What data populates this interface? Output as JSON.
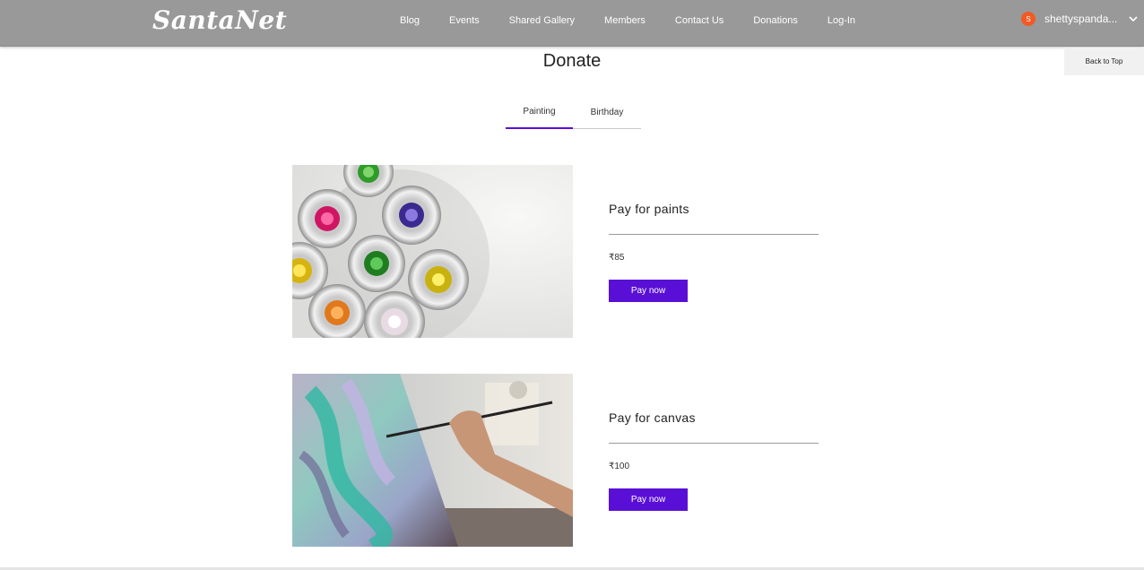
{
  "header": {
    "logo": "SantaNet",
    "nav": [
      "Blog",
      "Events",
      "Shared Gallery",
      "Members",
      "Contact Us",
      "Donations",
      "Log-In"
    ],
    "user": {
      "initial": "S",
      "name": "shettyspanda...",
      "avatar_color": "#f15a24"
    },
    "bar_color": "#999999"
  },
  "back_to_top": "Back to Top",
  "page": {
    "title": "Donate"
  },
  "tabs": [
    {
      "label": "Painting",
      "active": true
    },
    {
      "label": "Birthday",
      "active": false
    }
  ],
  "accent": "#5a0fd6",
  "products": [
    {
      "title": "Pay for paints",
      "price": "₹85",
      "button": "Pay now",
      "image": "paint-tubes-photo"
    },
    {
      "title": "Pay for canvas",
      "price": "₹100",
      "button": "Pay now",
      "image": "painting-on-canvas-photo"
    }
  ]
}
